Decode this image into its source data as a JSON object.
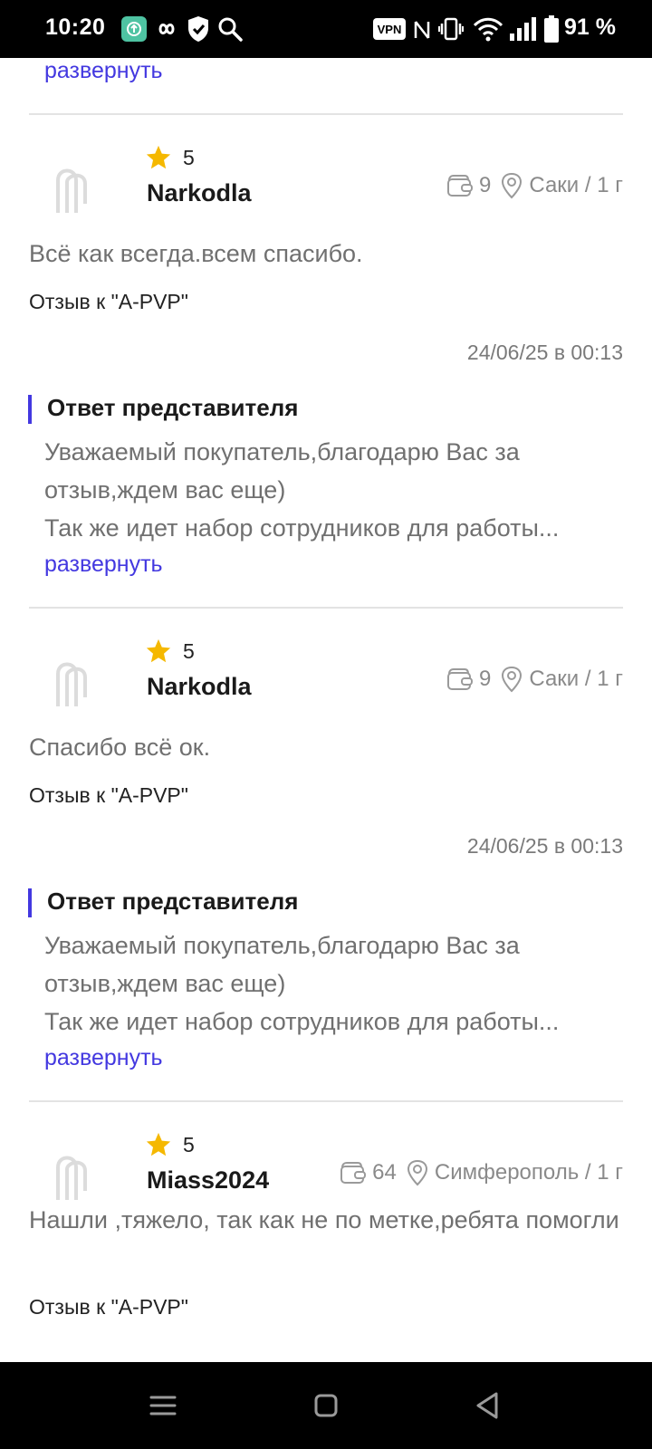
{
  "status_bar": {
    "time": "10:20",
    "vpn_label": "VPN",
    "battery_percent": "91 %",
    "icons": [
      "app-icon",
      "infinity-icon",
      "shield-check-icon",
      "search-icon",
      "vpn-icon",
      "nfc-icon",
      "vibrate-icon",
      "wifi-icon",
      "signal-icon",
      "battery-icon"
    ]
  },
  "top_expand": "развернуть",
  "reviews": [
    {
      "rating": "5",
      "username": "Narkodla",
      "orders": "9",
      "location": "Саки / 1 г",
      "text": "Всё как всегда.всем спасибо.",
      "review_to": "Отзыв к \"A-PVP\"",
      "date": "24/06/25 в 00:13",
      "answer_title": "Ответ представителя",
      "answer_line1": "Уважаемый покупатель,благодарю Вас за отзыв,ждем вас еще)",
      "answer_line2": "Так же идет набор сотрудников для работы...",
      "expand": "развернуть"
    },
    {
      "rating": "5",
      "username": "Narkodla",
      "orders": "9",
      "location": "Саки / 1 г",
      "text": "Спасибо всё ок.",
      "review_to": "Отзыв к \"A-PVP\"",
      "date": "24/06/25 в 00:13",
      "answer_title": "Ответ представителя",
      "answer_line1": "Уважаемый покупатель,благодарю Вас за отзыв,ждем вас еще)",
      "answer_line2": "Так же идет набор сотрудников для работы...",
      "expand": "развернуть"
    },
    {
      "rating": "5",
      "username": "Miass2024",
      "orders": "64",
      "location": "Симферополь / 1 г",
      "text": "Нашли ,тяжело, так как не по метке,ребята помогли",
      "review_to": "Отзыв к \"A-PVP\""
    }
  ],
  "colors": {
    "accent": "#4338e0",
    "star": "#f5b800",
    "muted_text": "#707070",
    "divider": "#e3e3e3"
  },
  "nav_bar": {
    "icons": [
      "menu-icon",
      "home-square-icon",
      "back-triangle-icon"
    ]
  }
}
